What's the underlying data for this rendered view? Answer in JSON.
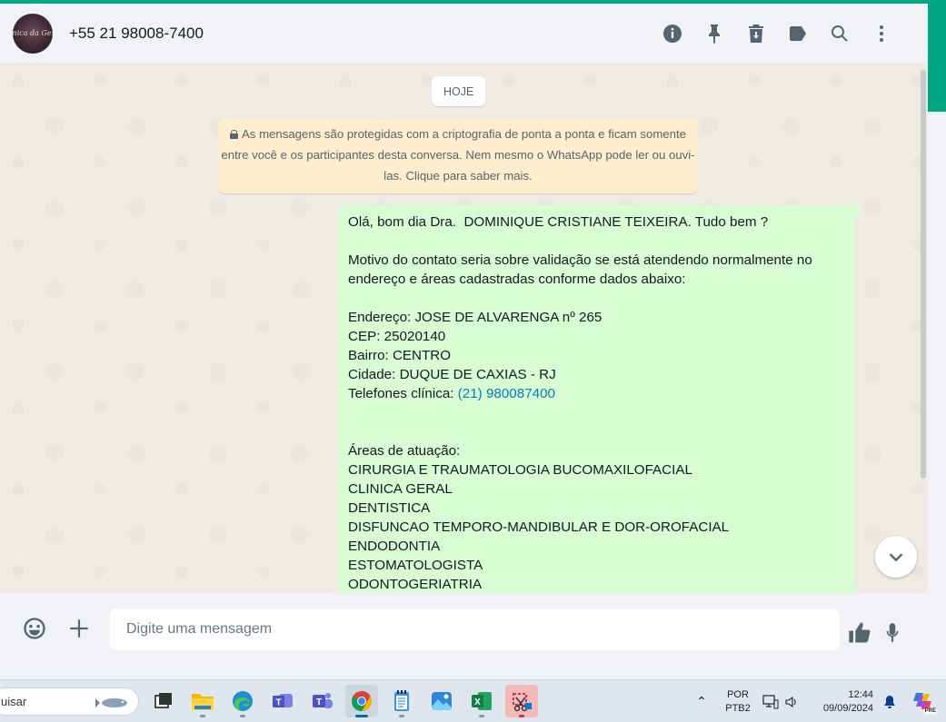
{
  "header": {
    "contact_name": "+55 21 98008-7400",
    "avatar_text": "Clínica da Gente",
    "icons": [
      "info-icon",
      "pin-icon",
      "delete-icon",
      "label-icon",
      "search-icon",
      "menu-icon"
    ]
  },
  "chat": {
    "date_chip": "HOJE",
    "encryption_notice": "As mensagens são protegidas com a criptografia de ponta a ponta e ficam somente entre você e os participantes desta conversa. Nem mesmo o WhatsApp pode ler ou ouvi-las. Clique para saber mais.",
    "message": {
      "greeting": "Olá, bom dia Dra.  DOMINIQUE CRISTIANE TEIXEIRA. Tudo bem ?",
      "motive": "Motivo do contato seria sobre validação se está atendendo normalmente no endereço e áreas cadastradas conforme dados abaixo:",
      "address": "Endereço: JOSE DE ALVARENGA nº 265",
      "cep": "CEP: 25020140",
      "bairro": "Bairro: CENTRO",
      "cidade": "Cidade: DUQUE DE CAXIAS - RJ",
      "phone_label": "Telefones clínica: ",
      "phone_link": "(21) 980087400",
      "areas_title": "Áreas de atuação:",
      "areas": [
        "CIRURGIA E TRAUMATOLOGIA BUCOMAXILOFACIAL",
        "CLINICA GERAL",
        "DENTISTICA",
        "DISFUNCAO TEMPORO-MANDIBULAR E DOR-OROFACIAL",
        "ENDODONTIA",
        "ESTOMATOLOGISTA",
        "ODONTOGERIATRIA"
      ]
    }
  },
  "footer": {
    "placeholder": "Digite uma mensagem"
  },
  "taskbar": {
    "search_text": "uisar",
    "language": "POR",
    "keyboard": "PTB2",
    "time": "12:44",
    "date": "09/09/2024",
    "copilot_badge": "PRE"
  }
}
